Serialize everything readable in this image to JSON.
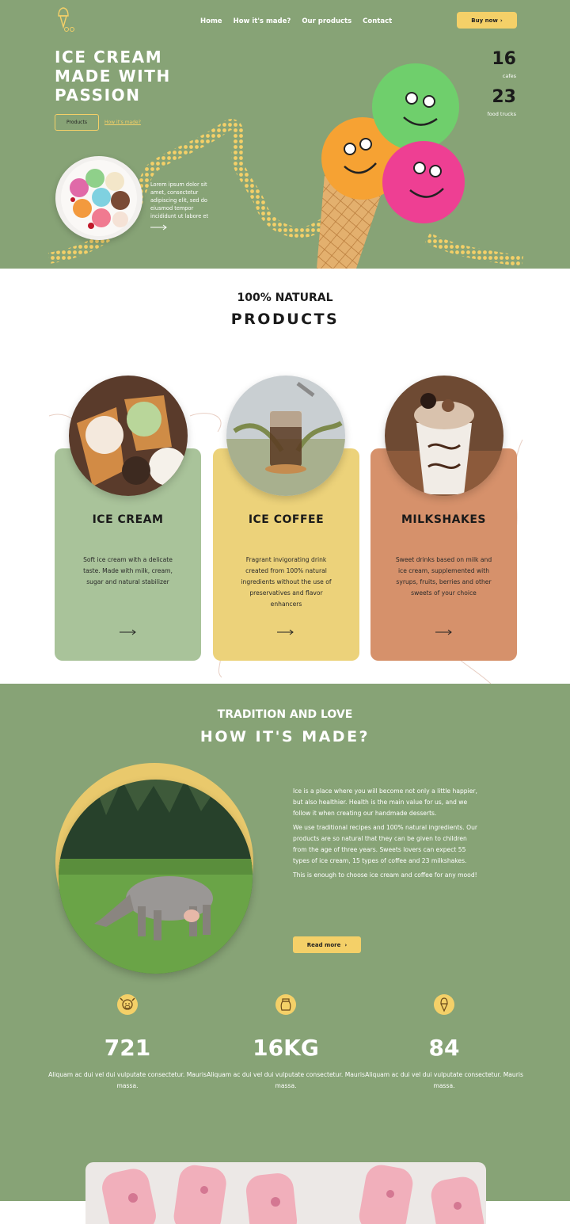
{
  "header": {
    "nav": [
      "Home",
      "How it's made?",
      "Our products",
      "Contact"
    ],
    "buy_label": "Buy now"
  },
  "hero": {
    "title_lines": [
      "ICE CREAM",
      "MADE WITH",
      "PASSION"
    ],
    "products_btn": "Products",
    "how_link": "How it's made?",
    "description": "Lorem ipsum dolor sit amet, consectetur adipiscing elit, sed do eiusmod tempor incididunt ut labore et",
    "stats": [
      {
        "value": "16",
        "label": "cafes"
      },
      {
        "value": "23",
        "label": "food trucks"
      }
    ]
  },
  "products": {
    "subtitle": "100% NATURAL",
    "title": "PRODUCTS",
    "cards": [
      {
        "title": "ICE CREAM",
        "text": "Soft ice cream with a delicate taste. Made with milk, cream, sugar and natural stabilizer"
      },
      {
        "title": "ICE COFFEE",
        "text": "Fragrant invigorating drink created from 100% natural ingredients without the use of preservatives and flavor enhancers"
      },
      {
        "title": "MILKSHAKES",
        "text": "Sweet drinks based on milk and ice cream, supplemented with syrups, fruits, berries and other sweets of your choice"
      }
    ]
  },
  "made": {
    "subtitle": "TRADITION AND LOVE",
    "title": "HOW IT'S MADE?",
    "paragraphs": [
      "Ice is a place where you will become not only a little happier, but also healthier. Health is the main value for us, and we follow it when creating our handmade desserts.",
      "We use traditional recipes and 100% natural ingredients. Our products are so natural that they can be given to children from the age of three years. Sweets lovers can expect 55 types of ice cream, 15 types of coffee and 23 milkshakes.",
      "This is enough to choose ice cream and coffee for any mood!"
    ],
    "read_more": "Read more",
    "stats": [
      {
        "icon": "cow-icon",
        "value": "721",
        "text": "Aliquam ac dui vel dui vulputate consectetur. Mauris massa."
      },
      {
        "icon": "milk-jar-icon",
        "value": "16KG",
        "text": "Aliquam ac dui vel dui vulputate consectetur. Mauris massa."
      },
      {
        "icon": "ice-cream-icon",
        "value": "84",
        "text": "Aliquam ac dui vel dui vulputate consectetur. Mauris massa."
      }
    ]
  },
  "colors": {
    "green": "#87a376",
    "yellow": "#f4d068",
    "card_green": "#a9c39a",
    "card_yellow": "#ecd27a",
    "card_orange": "#d6916b"
  }
}
